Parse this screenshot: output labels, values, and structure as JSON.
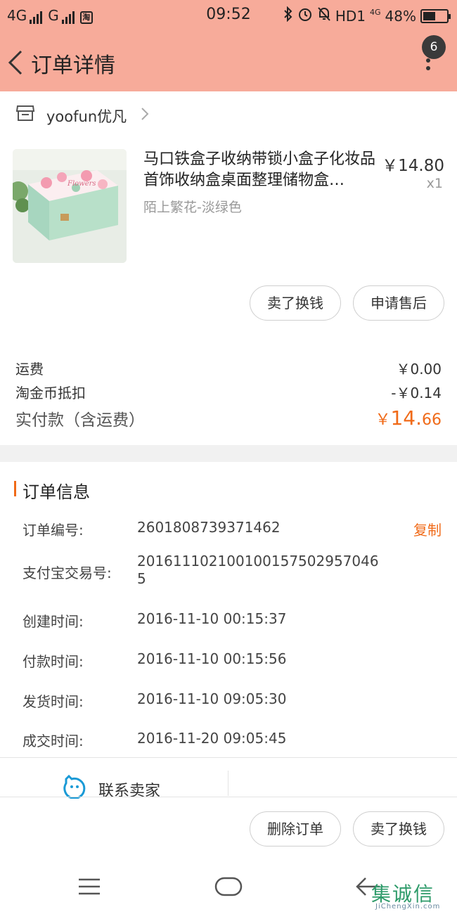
{
  "status_bar": {
    "network1": "4G",
    "network2": "G",
    "taobao_badge": "淘",
    "time": "09:52",
    "hd": "HD1",
    "net4g": "4G",
    "battery": "48%"
  },
  "nav": {
    "title": "订单详情",
    "message_count": "6"
  },
  "shop": {
    "name": "yoofun优凡"
  },
  "product": {
    "title": "马口铁盒子收纳带锁小盒子化妆品首饰收纳盒桌面整理储物盒…",
    "sku": "陌上繁花-淡绿色",
    "price": "￥14.80",
    "qty": "x1",
    "image_text": "Flowers"
  },
  "item_actions": {
    "sell_label": "卖了换钱",
    "after_sale_label": "申请售后"
  },
  "costs": {
    "shipping_label": "运费",
    "shipping_value": "￥0.00",
    "coin_label": "淘金币抵扣",
    "coin_value": "-￥0.14",
    "total_label": "实付款（含运费）",
    "total_currency": "￥",
    "total_int": "14.",
    "total_dec": "66"
  },
  "order_info": {
    "title": "订单信息",
    "copy_label": "复制",
    "rows": [
      {
        "label": "订单编号:",
        "value": "2601808739371462"
      },
      {
        "label": "支付宝交易号:",
        "value": "2016111021001001575029570465"
      },
      {
        "label": "创建时间:",
        "value": "2016-11-10 00:15:37"
      },
      {
        "label": "付款时间:",
        "value": "2016-11-10 00:15:56"
      },
      {
        "label": "发货时间:",
        "value": "2016-11-10 09:05:30"
      },
      {
        "label": "成交时间:",
        "value": "2016-11-20 09:05:45"
      }
    ]
  },
  "contact": {
    "label": "联系卖家"
  },
  "bottom_actions": {
    "delete_label": "删除订单",
    "sell_label": "卖了换钱"
  },
  "watermark": {
    "text": "集诚信",
    "sub": "JiChengXin.com"
  },
  "colors": {
    "header": "#f7ab9a",
    "accent": "#f06a18",
    "contact_icon": "#1a9ad6"
  }
}
